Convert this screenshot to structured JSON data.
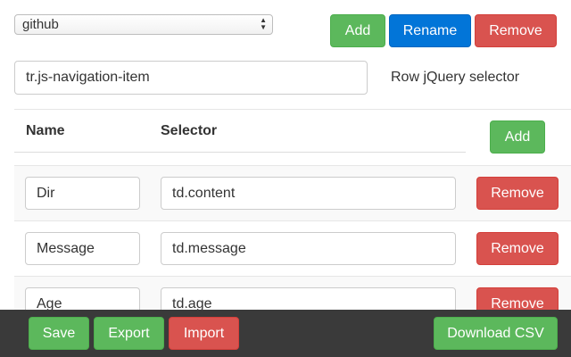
{
  "profile_select": {
    "value": "github"
  },
  "top_buttons": {
    "add": "Add",
    "rename": "Rename",
    "remove": "Remove"
  },
  "row_selector": {
    "value": "tr.js-navigation-item",
    "label": "Row jQuery selector"
  },
  "table": {
    "headers": {
      "name": "Name",
      "selector": "Selector"
    },
    "add_label": "Add",
    "rows": [
      {
        "name": "Dir",
        "selector": "td.content",
        "remove": "Remove"
      },
      {
        "name": "Message",
        "selector": "td.message",
        "remove": "Remove"
      },
      {
        "name": "Age",
        "selector": "td.age",
        "remove": "Remove"
      }
    ]
  },
  "footer": {
    "save": "Save",
    "export": "Export",
    "import": "Import",
    "download": "Download CSV"
  },
  "colors": {
    "green": "#5cb85c",
    "blue": "#0275d8",
    "red": "#d9534f",
    "footer_bg": "#3a3a3a"
  }
}
